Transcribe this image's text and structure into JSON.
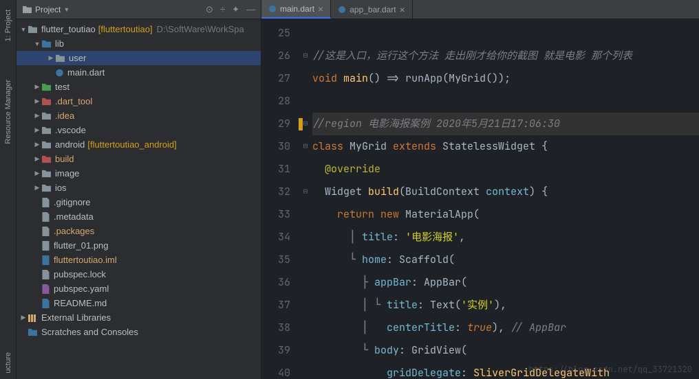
{
  "sideTabs": [
    {
      "label": "1: Project",
      "icon": "◧"
    },
    {
      "label": "Resource Manager",
      "icon": "◆"
    }
  ],
  "bottomTab": "ucture",
  "panel": {
    "title": "Project",
    "icons": [
      "⊙",
      "÷",
      "✦",
      "—"
    ]
  },
  "tree": {
    "root": {
      "name": "flutter_toutiao",
      "tag": "[fluttertoutiao]",
      "path": "D:\\SoftWare\\WorkSpa"
    },
    "lib": "lib",
    "user": "user",
    "main": "main.dart",
    "test": "test",
    "darttool": ".dart_tool",
    "idea": ".idea",
    "vscode": ".vscode",
    "android": "android",
    "androidTag": "[fluttertoutiao_android]",
    "build": "build",
    "image": "image",
    "ios": "ios",
    "gitignore": ".gitignore",
    "metadata": ".metadata",
    "packages": ".packages",
    "flutter01": "flutter_01.png",
    "iml": "fluttertoutiao.iml",
    "pubspeclock": "pubspec.lock",
    "pubspecyaml": "pubspec.yaml",
    "readme": "README.md",
    "extlib": "External Libraries",
    "scratch": "Scratches and Consoles"
  },
  "tabs": [
    {
      "label": "main.dart",
      "active": true
    },
    {
      "label": "app_bar.dart",
      "active": false
    }
  ],
  "gutter": [
    "25",
    "26",
    "27",
    "28",
    "29",
    "30",
    "31",
    "32",
    "33",
    "34",
    "35",
    "36",
    "37",
    "38",
    "39",
    "40"
  ],
  "code": {
    "l25": "",
    "c26": "//这是入口，运行这个方法 走出刚才给你的截图 就是电影 那个列表",
    "l27a": "void",
    "l27b": "main",
    "l27c": "() => ",
    "l27d": "runApp",
    "l27e": "(MyGrid());",
    "c29": "//region 电影海报案例 2020年5月21日17:06:30",
    "l30a": "class",
    "l30b": " MyGrid ",
    "l30c": "extends",
    "l30d": " StatelessWidget {",
    "l31": "@override",
    "l32a": "Widget ",
    "l32b": "build",
    "l32c": "(BuildContext ",
    "l32d": "context",
    "l32e": ") {",
    "l33a": "return",
    "l33b": " new",
    "l33c": " MaterialApp(",
    "l34a": "title",
    "l34b": ": ",
    "l34c": "'电影海报'",
    "l34d": ",",
    "l35a": "home",
    "l35b": ": Scaffold(",
    "l36a": "appBar",
    "l36b": ": AppBar(",
    "l37a": "title",
    "l37b": ": Text(",
    "l37c": "'实例'",
    "l37d": "),",
    "l38a": "centerTitle",
    "l38b": ": ",
    "l38c": "true",
    "l38d": "),",
    "l38e": " // AppBar",
    "l39a": "body",
    "l39b": ": GridView(",
    "l40a": "gridDelegate",
    "l40b": ": ",
    "l40c": "SliverGridDelegateWith"
  },
  "watermark": "https://blog.csdn.net/qq_33721320",
  "marker32": "o↑"
}
